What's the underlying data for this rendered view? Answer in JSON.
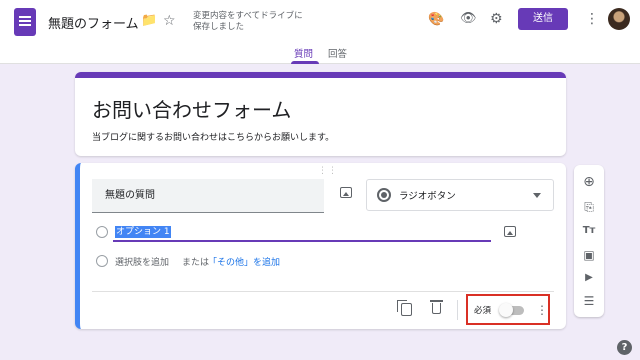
{
  "header": {
    "title": "無題のフォーム",
    "status_line1": "変更内容をすべてドライブに",
    "status_line2": "保存しました",
    "send_label": "送信",
    "folder_icon": "📁",
    "star_icon": "☆",
    "palette_icon": "🎨",
    "preview_icon": "👁",
    "settings_icon": "⚙",
    "more_icon": "⋮"
  },
  "tabs": [
    {
      "label": "質問",
      "active": true
    },
    {
      "label": "回答",
      "active": false
    }
  ],
  "form": {
    "title": "お問い合わせフォーム",
    "description": "当ブログに関するお問い合わせはこちらからお願いします。"
  },
  "question": {
    "drag_handle": "⋮⋮",
    "title": "無題の質問",
    "type": "ラジオボタン",
    "option1": "オプション 1",
    "add_option": "選択肢を追加",
    "or_text": "または",
    "add_other": "「その他」を追加",
    "required_label": "必須",
    "required_on": false,
    "more_icon": "⋮"
  },
  "toolbar": {
    "add": "⊕",
    "import": "⎘",
    "text": "Tт",
    "image": "▣",
    "video": "▶",
    "section": "☰"
  },
  "help_label": "?"
}
